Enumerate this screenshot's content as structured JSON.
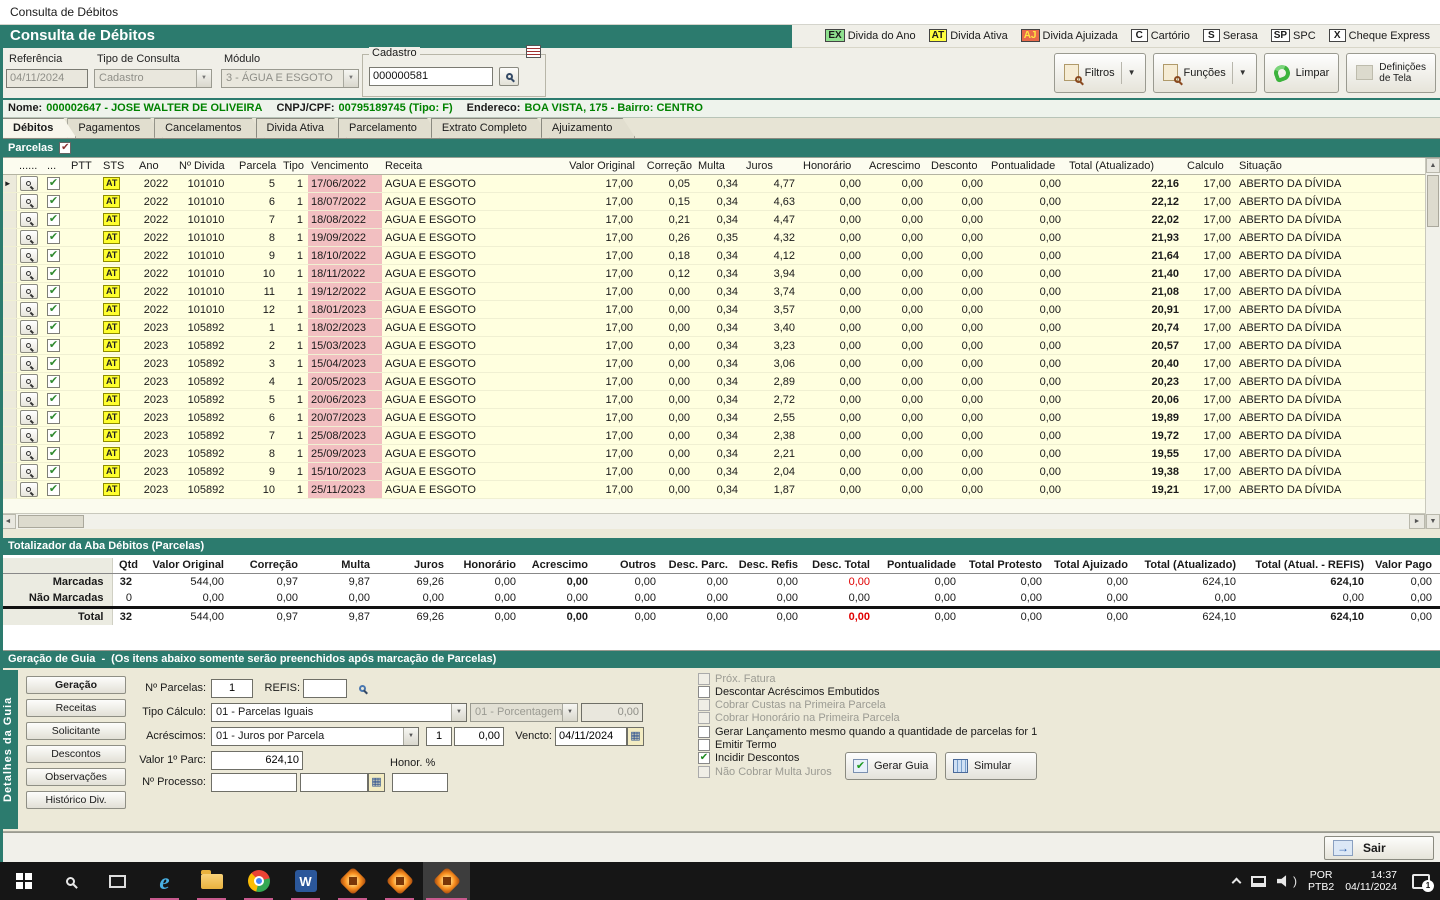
{
  "window": {
    "title": "Consulta de Débitos"
  },
  "banner": {
    "title": "Consulta de Débitos"
  },
  "legend": [
    {
      "code": "EX",
      "label": "Divida do Ano",
      "bg": "#8ee08e"
    },
    {
      "code": "AT",
      "label": "Divida Ativa",
      "bg": "#ffff3e"
    },
    {
      "code": "AJ",
      "label": "Divida Ajuizada",
      "bg": "#e86a4a",
      "fg": "#ffe840"
    },
    {
      "code": "C",
      "label": "Cartório",
      "bg": "#ffffff"
    },
    {
      "code": "S",
      "label": "Serasa",
      "bg": "#ffffff"
    },
    {
      "code": "SP",
      "label": "SPC",
      "bg": "#ffffff"
    },
    {
      "code": "X",
      "label": "Cheque Express",
      "bg": "#ffffff"
    }
  ],
  "form": {
    "referencia_label": "Referência",
    "referencia_value": "04/11/2024",
    "tipo_label": "Tipo de Consulta",
    "tipo_value": "Cadastro",
    "modulo_label": "Módulo",
    "modulo_value": "3 - ÁGUA E ESGOTO",
    "cadastro_label": "Cadastro",
    "cadastro_value": "000000581"
  },
  "toolbar": {
    "filtros": "Filtros",
    "funcoes": "Funções",
    "limpar": "Limpar",
    "definicoes_l1": "Definições",
    "definicoes_l2": "de Tela"
  },
  "info": {
    "nome_label": "Nome:",
    "nome_value": "000002647 - JOSE WALTER DE OLIVEIRA",
    "cpf_label": "CNPJ/CPF:",
    "cpf_value": "00795189745 (Tipo: F)",
    "endereco_label": "Endereco:",
    "endereco_value": "BOA VISTA, 175 - Bairro: CENTRO"
  },
  "tabs": [
    "Débitos",
    "Pagamentos",
    "Cancelamentos",
    "Divida Ativa",
    "Parcelamento",
    "Extrato Completo",
    "Ajuizamento"
  ],
  "parcelas_label": "Parcelas",
  "grid": {
    "headers": [
      "......",
      "...",
      "PTT",
      "STS",
      "Ano",
      "Nº Divida",
      "Parcela",
      "Tipo",
      "Vencimento",
      "Receita",
      "Valor Original",
      "Correção",
      "Multa",
      "Juros",
      "Honorário",
      "Acrescimo",
      "Desconto",
      "Pontualidade",
      "Total (Atualizado)",
      "Calculo",
      "Situação"
    ],
    "sts_badge": "AT",
    "rows": [
      [
        "2022",
        "101010",
        "5",
        "1",
        "17/06/2022",
        "AGUA E ESGOTO",
        "17,00",
        "0,05",
        "0,34",
        "4,77",
        "0,00",
        "0,00",
        "0,00",
        "0,00",
        "22,16",
        "17,00",
        "ABERTO DA DÍVIDA"
      ],
      [
        "2022",
        "101010",
        "6",
        "1",
        "18/07/2022",
        "AGUA E ESGOTO",
        "17,00",
        "0,15",
        "0,34",
        "4,63",
        "0,00",
        "0,00",
        "0,00",
        "0,00",
        "22,12",
        "17,00",
        "ABERTO DA DÍVIDA"
      ],
      [
        "2022",
        "101010",
        "7",
        "1",
        "18/08/2022",
        "AGUA E ESGOTO",
        "17,00",
        "0,21",
        "0,34",
        "4,47",
        "0,00",
        "0,00",
        "0,00",
        "0,00",
        "22,02",
        "17,00",
        "ABERTO DA DÍVIDA"
      ],
      [
        "2022",
        "101010",
        "8",
        "1",
        "19/09/2022",
        "AGUA E ESGOTO",
        "17,00",
        "0,26",
        "0,35",
        "4,32",
        "0,00",
        "0,00",
        "0,00",
        "0,00",
        "21,93",
        "17,00",
        "ABERTO DA DÍVIDA"
      ],
      [
        "2022",
        "101010",
        "9",
        "1",
        "18/10/2022",
        "AGUA E ESGOTO",
        "17,00",
        "0,18",
        "0,34",
        "4,12",
        "0,00",
        "0,00",
        "0,00",
        "0,00",
        "21,64",
        "17,00",
        "ABERTO DA DÍVIDA"
      ],
      [
        "2022",
        "101010",
        "10",
        "1",
        "18/11/2022",
        "AGUA E ESGOTO",
        "17,00",
        "0,12",
        "0,34",
        "3,94",
        "0,00",
        "0,00",
        "0,00",
        "0,00",
        "21,40",
        "17,00",
        "ABERTO DA DÍVIDA"
      ],
      [
        "2022",
        "101010",
        "11",
        "1",
        "19/12/2022",
        "AGUA E ESGOTO",
        "17,00",
        "0,00",
        "0,34",
        "3,74",
        "0,00",
        "0,00",
        "0,00",
        "0,00",
        "21,08",
        "17,00",
        "ABERTO DA DÍVIDA"
      ],
      [
        "2022",
        "101010",
        "12",
        "1",
        "18/01/2023",
        "AGUA E ESGOTO",
        "17,00",
        "0,00",
        "0,34",
        "3,57",
        "0,00",
        "0,00",
        "0,00",
        "0,00",
        "20,91",
        "17,00",
        "ABERTO DA DÍVIDA"
      ],
      [
        "2023",
        "105892",
        "1",
        "1",
        "18/02/2023",
        "AGUA E ESGOTO",
        "17,00",
        "0,00",
        "0,34",
        "3,40",
        "0,00",
        "0,00",
        "0,00",
        "0,00",
        "20,74",
        "17,00",
        "ABERTO DA DÍVIDA"
      ],
      [
        "2023",
        "105892",
        "2",
        "1",
        "15/03/2023",
        "AGUA E ESGOTO",
        "17,00",
        "0,00",
        "0,34",
        "3,23",
        "0,00",
        "0,00",
        "0,00",
        "0,00",
        "20,57",
        "17,00",
        "ABERTO DA DÍVIDA"
      ],
      [
        "2023",
        "105892",
        "3",
        "1",
        "15/04/2023",
        "AGUA E ESGOTO",
        "17,00",
        "0,00",
        "0,34",
        "3,06",
        "0,00",
        "0,00",
        "0,00",
        "0,00",
        "20,40",
        "17,00",
        "ABERTO DA DÍVIDA"
      ],
      [
        "2023",
        "105892",
        "4",
        "1",
        "20/05/2023",
        "AGUA E ESGOTO",
        "17,00",
        "0,00",
        "0,34",
        "2,89",
        "0,00",
        "0,00",
        "0,00",
        "0,00",
        "20,23",
        "17,00",
        "ABERTO DA DÍVIDA"
      ],
      [
        "2023",
        "105892",
        "5",
        "1",
        "20/06/2023",
        "AGUA E ESGOTO",
        "17,00",
        "0,00",
        "0,34",
        "2,72",
        "0,00",
        "0,00",
        "0,00",
        "0,00",
        "20,06",
        "17,00",
        "ABERTO DA DÍVIDA"
      ],
      [
        "2023",
        "105892",
        "6",
        "1",
        "20/07/2023",
        "AGUA E ESGOTO",
        "17,00",
        "0,00",
        "0,34",
        "2,55",
        "0,00",
        "0,00",
        "0,00",
        "0,00",
        "19,89",
        "17,00",
        "ABERTO DA DÍVIDA"
      ],
      [
        "2023",
        "105892",
        "7",
        "1",
        "25/08/2023",
        "AGUA E ESGOTO",
        "17,00",
        "0,00",
        "0,34",
        "2,38",
        "0,00",
        "0,00",
        "0,00",
        "0,00",
        "19,72",
        "17,00",
        "ABERTO DA DÍVIDA"
      ],
      [
        "2023",
        "105892",
        "8",
        "1",
        "25/09/2023",
        "AGUA E ESGOTO",
        "17,00",
        "0,00",
        "0,34",
        "2,21",
        "0,00",
        "0,00",
        "0,00",
        "0,00",
        "19,55",
        "17,00",
        "ABERTO DA DÍVIDA"
      ],
      [
        "2023",
        "105892",
        "9",
        "1",
        "15/10/2023",
        "AGUA E ESGOTO",
        "17,00",
        "0,00",
        "0,34",
        "2,04",
        "0,00",
        "0,00",
        "0,00",
        "0,00",
        "19,38",
        "17,00",
        "ABERTO DA DÍVIDA"
      ],
      [
        "2023",
        "105892",
        "10",
        "1",
        "25/11/2023",
        "AGUA E ESGOTO",
        "17,00",
        "0,00",
        "0,34",
        "1,87",
        "0,00",
        "0,00",
        "0,00",
        "0,00",
        "19,21",
        "17,00",
        "ABERTO DA DÍVIDA"
      ]
    ]
  },
  "totalizador": {
    "title": "Totalizador da Aba Débitos (Parcelas)",
    "headers": [
      "Qtd",
      "Valor Original",
      "Correção",
      "Multa",
      "Juros",
      "Honorário",
      "Acrescimo",
      "Outros",
      "Desc. Parc.",
      "Desc. Refis",
      "Desc. Total",
      "Pontualidade",
      "Total Protesto",
      "Total Ajuizado",
      "Total (Atualizado)",
      "Total (Atual. - REFIS)",
      "Valor Pago"
    ],
    "rows": [
      {
        "label": "Marcadas",
        "values": [
          "32",
          "544,00",
          "0,97",
          "9,87",
          "69,26",
          "0,00",
          "0,00",
          "0,00",
          "0,00",
          "0,00",
          "0,00",
          "0,00",
          "0,00",
          "0,00",
          "624,10",
          "624,10",
          "0,00"
        ]
      },
      {
        "label": "Não Marcadas",
        "values": [
          "0",
          "0,00",
          "0,00",
          "0,00",
          "0,00",
          "0,00",
          "0,00",
          "0,00",
          "0,00",
          "0,00",
          "0,00",
          "0,00",
          "0,00",
          "0,00",
          "0,00",
          "0,00",
          "0,00"
        ]
      },
      {
        "label": "Total",
        "values": [
          "32",
          "544,00",
          "0,97",
          "9,87",
          "69,26",
          "0,00",
          "0,00",
          "0,00",
          "0,00",
          "0,00",
          "0,00",
          "0,00",
          "0,00",
          "0,00",
          "624,10",
          "624,10",
          "0,00"
        ]
      }
    ]
  },
  "geracao": {
    "title": "Geração de Guia",
    "dash": "-",
    "subtitle": "(Os itens abaixo somente serão preenchidos após marcação de Parcelas)",
    "side_label": "Detalhes da Guia",
    "buttons": [
      "Geração",
      "Receitas",
      "Solicitante",
      "Descontos",
      "Observações",
      "Histórico Div."
    ],
    "fields": {
      "n_parcelas_label": "Nº Parcelas:",
      "n_parcelas_value": "1",
      "refis_label": "REFIS:",
      "refis_value": "",
      "tipo_calculo_label": "Tipo Cálculo:",
      "tipo_calculo_value": "01 - Parcelas Iguais",
      "porcentagem_value": "01 - Porcentagem",
      "porcentagem_num": "0,00",
      "acrescimos_label": "Acréscimos:",
      "acrescimos_value": "01 - Juros por Parcela",
      "acrescimos_n": "1",
      "acrescimos_num": "0,00",
      "vencto_label": "Vencto:",
      "vencto_value": "04/11/2024",
      "valor1_label": "Valor 1º Parc:",
      "valor1_value": "624,10",
      "processo_label": "Nº Processo:",
      "processo_value": "",
      "honor_label": "Honor. %",
      "honor_value": ""
    },
    "checkboxes": [
      {
        "label": "Próx. Fatura",
        "checked": false,
        "disabled": true
      },
      {
        "label": "Descontar Acréscimos Embutidos",
        "checked": false,
        "disabled": false
      },
      {
        "label": "Cobrar Custas na Primeira Parcela",
        "checked": false,
        "disabled": true
      },
      {
        "label": "Cobrar Honorário na Primeira Parcela",
        "checked": false,
        "disabled": true
      },
      {
        "label": "Gerar Lançamento mesmo quando a quantidade de parcelas for 1",
        "checked": false,
        "disabled": false
      },
      {
        "label": "Emitir Termo",
        "checked": false,
        "disabled": false
      },
      {
        "label": "Incidir Descontos",
        "checked": true,
        "disabled": false
      },
      {
        "label": "Não Cobrar Multa Juros",
        "checked": false,
        "disabled": true
      }
    ],
    "gerar_guia": "Gerar Guia",
    "simular": "Simular"
  },
  "bottom": {
    "sair": "Sair"
  },
  "taskbar": {
    "lang1": "POR",
    "lang2": "PTB2",
    "time": "14:37",
    "date": "04/11/2024",
    "badge": "1"
  }
}
